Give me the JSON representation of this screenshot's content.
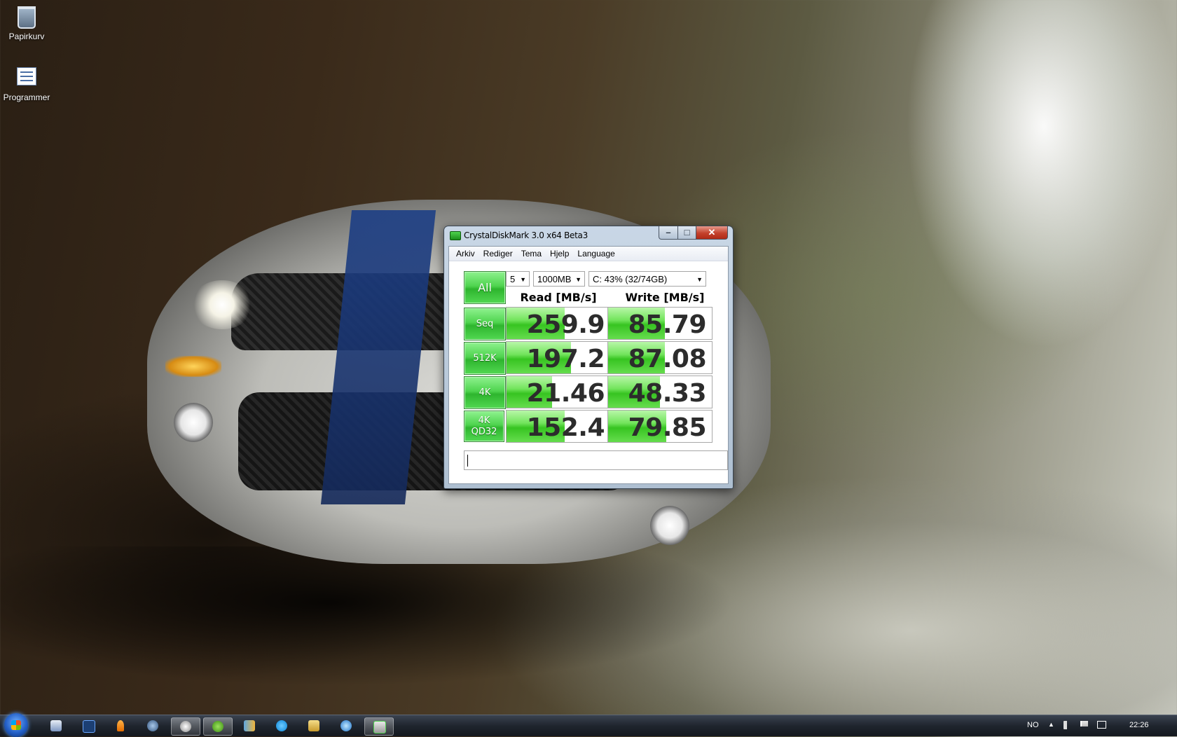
{
  "desktop": {
    "icons": [
      {
        "label": "Papirkurv",
        "icon": "recycle-bin-icon"
      },
      {
        "label": "Programmer",
        "icon": "program-list-icon"
      }
    ]
  },
  "window": {
    "title": "CrystalDiskMark 3.0 x64 Beta3",
    "menu": [
      "Arkiv",
      "Rediger",
      "Tema",
      "Hjelp",
      "Language"
    ],
    "all_button": "All",
    "count_select": "5",
    "size_select": "1000MB",
    "drive_select": "C: 43% (32/74GB)",
    "read_header": "Read [MB/s]",
    "write_header": "Write [MB/s]",
    "rows": [
      {
        "label": "Seq",
        "read": "259.9",
        "write": "85.79",
        "read_level": 0.56,
        "write_level": 0.55
      },
      {
        "label": "512K",
        "read": "197.2",
        "write": "87.08",
        "read_level": 0.62,
        "write_level": 0.55
      },
      {
        "label": "4K",
        "read": "21.46",
        "write": "48.33",
        "read_level": 0.44,
        "write_level": 0.5
      },
      {
        "label_line1": "4K",
        "label_line2": "QD32",
        "read": "152.4",
        "write": "79.85",
        "read_level": 0.56,
        "write_level": 0.56
      }
    ],
    "comment": ""
  },
  "taskbar": {
    "language": "NO",
    "clock": "22:26",
    "apps": [
      "explorer-icon",
      "photoshop-icon",
      "vlc-icon",
      "messenger-icon",
      "steam-icon",
      "spotify-icon",
      "people-icon",
      "skype-icon",
      "folder-icon",
      "internet-explorer-icon",
      "crystaldiskmark-icon"
    ]
  },
  "colors": {
    "accent_green": "#4fd44f",
    "close_red": "#c3412c"
  }
}
